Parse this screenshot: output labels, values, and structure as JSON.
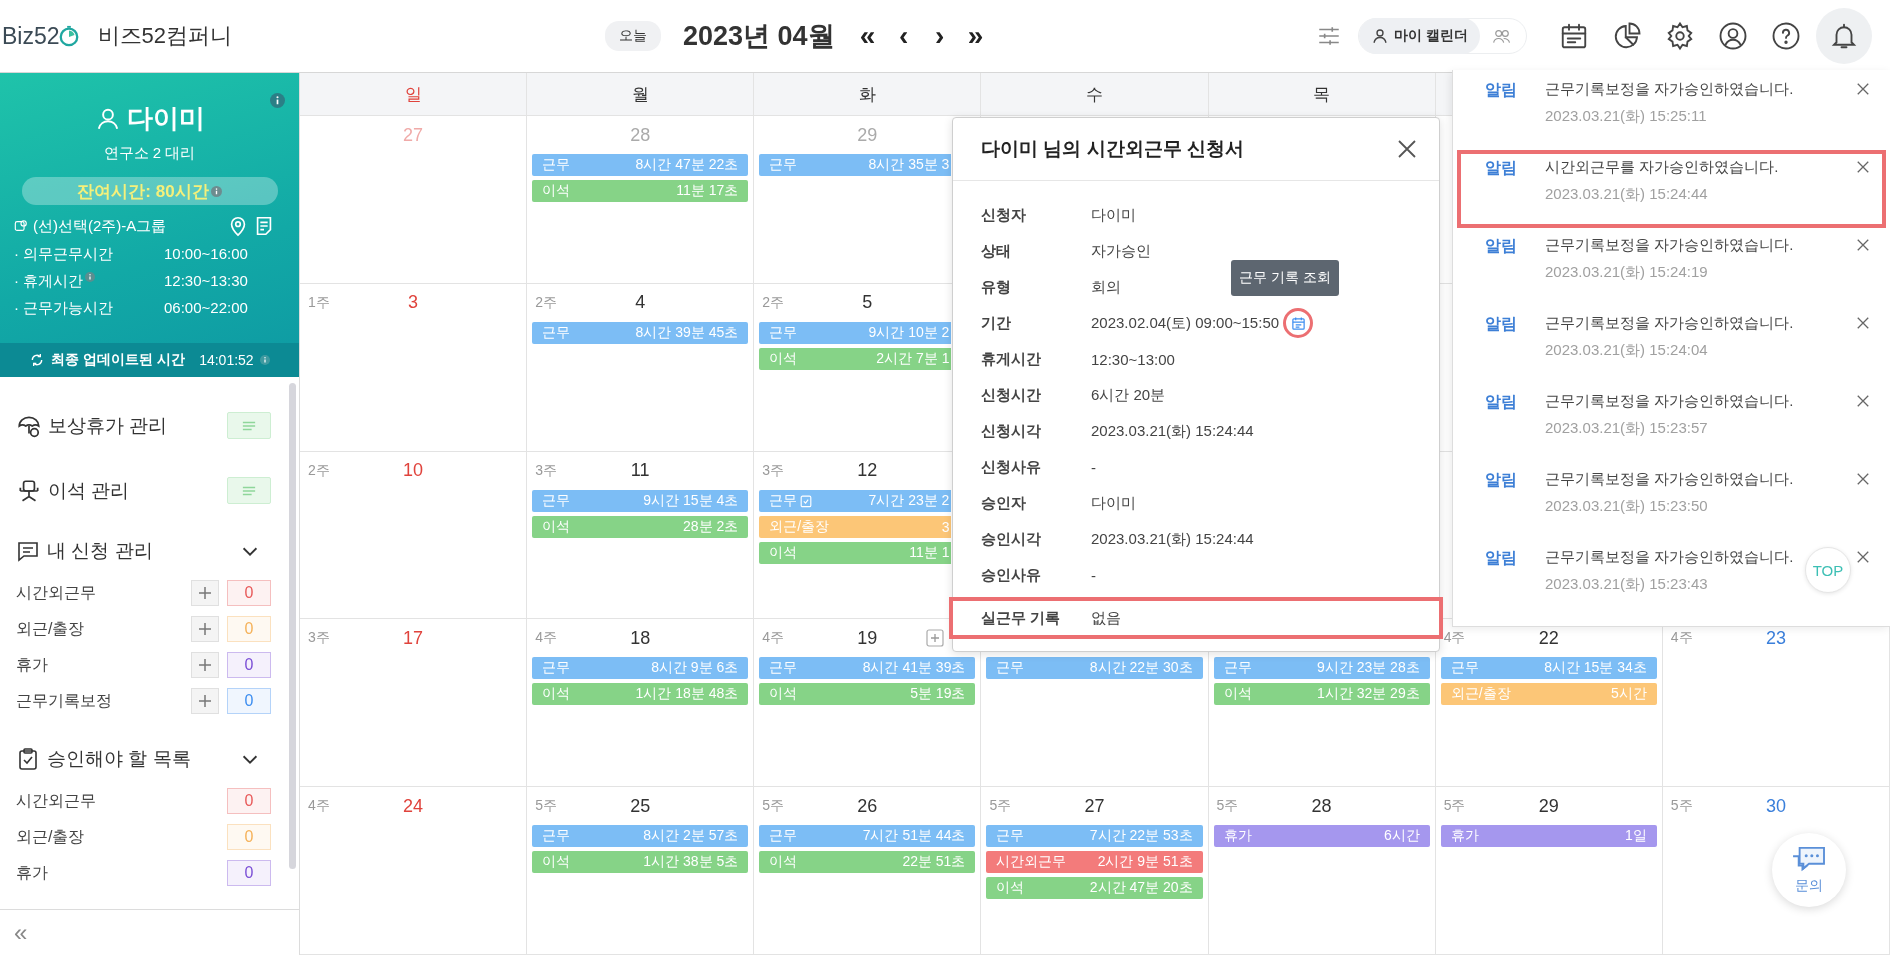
{
  "header": {
    "logo": "Biz52",
    "company": "비즈52컴퍼니",
    "today_button": "오늘",
    "month": "2023년 04월",
    "nav": [
      "«",
      "‹",
      "›",
      "»"
    ],
    "calendar_switch": {
      "label": "마이 캘린더",
      "selected": true,
      "group_selected": false
    },
    "icons": [
      {
        "kind": "calendar",
        "selected": false
      },
      {
        "kind": "chart",
        "selected": false
      },
      {
        "kind": "settings",
        "selected": false
      },
      {
        "kind": "account",
        "selected": false
      },
      {
        "kind": "help",
        "selected": false
      },
      {
        "kind": "bell",
        "selected": true
      }
    ]
  },
  "profile": {
    "name": "다이미",
    "position": "연구소 2 대리",
    "remaining": "잔여시간: 80시간",
    "group": "(선)선택(2주)-A그룹",
    "schedule": [
      {
        "label": "· 의무근무시간",
        "value": "10:00~16:00",
        "info": false
      },
      {
        "label": "· 휴게시간",
        "value": "12:30~13:30",
        "info": true
      },
      {
        "label": "· 근무가능시간",
        "value": "06:00~22:00",
        "info": false
      }
    ],
    "updated_label": "최종 업데이트된 시간",
    "updated_time": "14:01:52"
  },
  "menu": {
    "links": [
      {
        "kind": "umbrella",
        "label": "보상휴가 관리"
      },
      {
        "kind": "chair",
        "label": "이석 관리"
      }
    ],
    "sections": [
      {
        "kind": "chat",
        "title": "내 신청 관리",
        "expanded": true,
        "items": [
          {
            "label": "시간외근무",
            "count": "0",
            "color": "#e85a5a",
            "addable": true
          },
          {
            "label": "외근/출장",
            "count": "0",
            "color": "#f5b25a",
            "addable": true
          },
          {
            "label": "휴가",
            "count": "0",
            "color": "#7b4fd6",
            "addable": true
          },
          {
            "label": "근무기록보정",
            "count": "0",
            "color": "#3d8ef0",
            "addable": true
          }
        ]
      },
      {
        "kind": "clipboard",
        "title": "승인해야 할 목록",
        "expanded": true,
        "items": [
          {
            "label": "시간외근무",
            "count": "0",
            "color": "#e85a5a",
            "addable": false
          },
          {
            "label": "외근/출장",
            "count": "0",
            "color": "#f5b25a",
            "addable": false
          },
          {
            "label": "휴가",
            "count": "0",
            "color": "#7b4fd6",
            "addable": false
          }
        ]
      }
    ],
    "collapse": "«"
  },
  "calendar": {
    "weekdays": [
      "일",
      "월",
      "화",
      "수",
      "목"
    ],
    "weeks": [
      {
        "cells": [
          {
            "date": "27",
            "muted": true
          },
          {
            "date": "28",
            "muted": true,
            "bars": [
              {
                "kind": "work",
                "label": "근무",
                "value": "8시간 47분 22초"
              },
              {
                "kind": "away",
                "label": "이석",
                "value": "11분 17초"
              }
            ]
          },
          {
            "date": "29",
            "muted": true,
            "bars": [
              {
                "kind": "work",
                "label": "근무",
                "value": "8시간 35분 3",
                "cut": true
              }
            ]
          },
          null,
          null,
          null,
          null
        ]
      },
      {
        "cells": [
          {
            "week": "1주",
            "date": "3"
          },
          {
            "week": "2주",
            "date": "4",
            "bars": [
              {
                "kind": "work",
                "label": "근무",
                "value": "8시간 39분 45초"
              }
            ]
          },
          {
            "week": "2주",
            "date": "5",
            "bars": [
              {
                "kind": "work",
                "label": "근무",
                "value": "9시간 10분 2",
                "cut": true
              },
              {
                "kind": "away",
                "label": "이석",
                "value": "2시간 7분 1",
                "cut": true
              }
            ]
          },
          null,
          null,
          null,
          null
        ]
      },
      {
        "cells": [
          {
            "week": "2주",
            "date": "10"
          },
          {
            "week": "3주",
            "date": "11",
            "bars": [
              {
                "kind": "work",
                "label": "근무",
                "value": "9시간 15분 4초"
              },
              {
                "kind": "away",
                "label": "이석",
                "value": "28분 2초"
              }
            ]
          },
          {
            "week": "3주",
            "date": "12",
            "bars": [
              {
                "kind": "work",
                "label": "근무",
                "value": "7시간 23분 2",
                "cut": true,
                "icon": true
              },
              {
                "kind": "outside",
                "label": "외근/출장",
                "value": "3",
                "cut": true
              },
              {
                "kind": "away",
                "label": "이석",
                "value": "11분 1",
                "cut": true
              }
            ]
          },
          null,
          null,
          null,
          null
        ]
      },
      {
        "cells": [
          {
            "week": "3주",
            "date": "17"
          },
          {
            "week": "4주",
            "date": "18",
            "bars": [
              {
                "kind": "work",
                "label": "근무",
                "value": "8시간 9분 6초"
              },
              {
                "kind": "away",
                "label": "이석",
                "value": "1시간 18분 48초"
              }
            ]
          },
          {
            "week": "4주",
            "date": "19",
            "add": true,
            "bars": [
              {
                "kind": "work",
                "label": "근무",
                "value": "8시간 41분 39초"
              },
              {
                "kind": "away",
                "label": "이석",
                "value": "5분 19초"
              }
            ]
          },
          {
            "bars": [
              {
                "kind": "work",
                "label": "근무",
                "value": "8시간 22분 30초"
              }
            ]
          },
          {
            "bars": [
              {
                "kind": "work",
                "label": "근무",
                "value": "9시간 23분 28초"
              },
              {
                "kind": "away",
                "label": "이석",
                "value": "1시간 32분 29초"
              }
            ]
          },
          {
            "week": "4주",
            "date": "22",
            "bars": [
              {
                "kind": "work",
                "label": "근무",
                "value": "8시간 15분 34초"
              },
              {
                "kind": "outside",
                "label": "외근/출장",
                "value": "5시간"
              }
            ]
          },
          {
            "week": "4주",
            "date": "23"
          }
        ]
      },
      {
        "cells": [
          {
            "week": "4주",
            "date": "24"
          },
          {
            "week": "5주",
            "date": "25",
            "bars": [
              {
                "kind": "work",
                "label": "근무",
                "value": "8시간 2분 57초"
              },
              {
                "kind": "away",
                "label": "이석",
                "value": "1시간 38분 5초"
              }
            ]
          },
          {
            "week": "5주",
            "date": "26",
            "bars": [
              {
                "kind": "work",
                "label": "근무",
                "value": "7시간 51분 44초"
              },
              {
                "kind": "away",
                "label": "이석",
                "value": "22분 51초"
              }
            ]
          },
          {
            "week": "5주",
            "date": "27",
            "bars": [
              {
                "kind": "work",
                "label": "근무",
                "value": "7시간 22분 53초"
              },
              {
                "kind": "overtime",
                "label": "시간외근무",
                "value": "2시간 9분 51초"
              },
              {
                "kind": "away",
                "label": "이석",
                "value": "2시간 47분 20초"
              }
            ]
          },
          {
            "week": "5주",
            "date": "28",
            "bars": [
              {
                "kind": "leave",
                "label": "휴가",
                "value": "6시간"
              }
            ]
          },
          {
            "week": "5주",
            "date": "29",
            "bars": [
              {
                "kind": "leave",
                "label": "휴가",
                "value": "1일"
              }
            ]
          },
          {
            "week": "5주",
            "date": "30"
          }
        ]
      }
    ]
  },
  "request_popup": {
    "title": "다이미 님의 시간외근무 신청서",
    "fields": [
      {
        "label": "신청자",
        "value": "다이미",
        "highlighted": false
      },
      {
        "label": "상태",
        "value": "자가승인",
        "highlighted": false
      },
      {
        "label": "유형",
        "value": "회의",
        "highlighted": false
      },
      {
        "label": "기간",
        "value": "2023.02.04(토) 09:00~15:50",
        "highlighted": false,
        "action": {
          "tooltip": "근무 기록 조회",
          "highlighted": true
        }
      },
      {
        "label": "휴게시간",
        "value": "12:30~13:00",
        "highlighted": false
      },
      {
        "label": "신청시간",
        "value": "6시간 20분",
        "highlighted": false
      },
      {
        "label": "신청시각",
        "value": "2023.03.21(화) 15:24:44",
        "highlighted": false
      },
      {
        "label": "신청사유",
        "value": "-",
        "highlighted": false
      },
      {
        "label": "승인자",
        "value": "다이미",
        "highlighted": false
      },
      {
        "label": "승인시각",
        "value": "2023.03.21(화) 15:24:44",
        "highlighted": false
      },
      {
        "label": "승인사유",
        "value": "-",
        "highlighted": false
      },
      {
        "label": "실근무 기록",
        "value": "없음",
        "highlighted": true
      }
    ]
  },
  "notifications": {
    "items": [
      {
        "tag": "알림",
        "message": "근무기록보정을 자가승인하였습니다.",
        "time": "2023.03.21(화) 15:25:11",
        "highlighted": false
      },
      {
        "tag": "알림",
        "message": "시간외근무를 자가승인하였습니다.",
        "time": "2023.03.21(화) 15:24:44",
        "highlighted": true
      },
      {
        "tag": "알림",
        "message": "근무기록보정을 자가승인하였습니다.",
        "time": "2023.03.21(화) 15:24:19",
        "highlighted": false
      },
      {
        "tag": "알림",
        "message": "근무기록보정을 자가승인하였습니다.",
        "time": "2023.03.21(화) 15:24:04",
        "highlighted": false
      },
      {
        "tag": "알림",
        "message": "근무기록보정을 자가승인하였습니다.",
        "time": "2023.03.21(화) 15:23:57",
        "highlighted": false
      },
      {
        "tag": "알림",
        "message": "근무기록보정을 자가승인하였습니다.",
        "time": "2023.03.21(화) 15:23:50",
        "highlighted": false
      },
      {
        "tag": "알림",
        "message": "근무기록보정을 자가승인하였습니다.",
        "time": "2023.03.21(화) 15:23:43",
        "highlighted": false
      }
    ],
    "top_button": "TOP"
  },
  "inquiry_button": "문의"
}
